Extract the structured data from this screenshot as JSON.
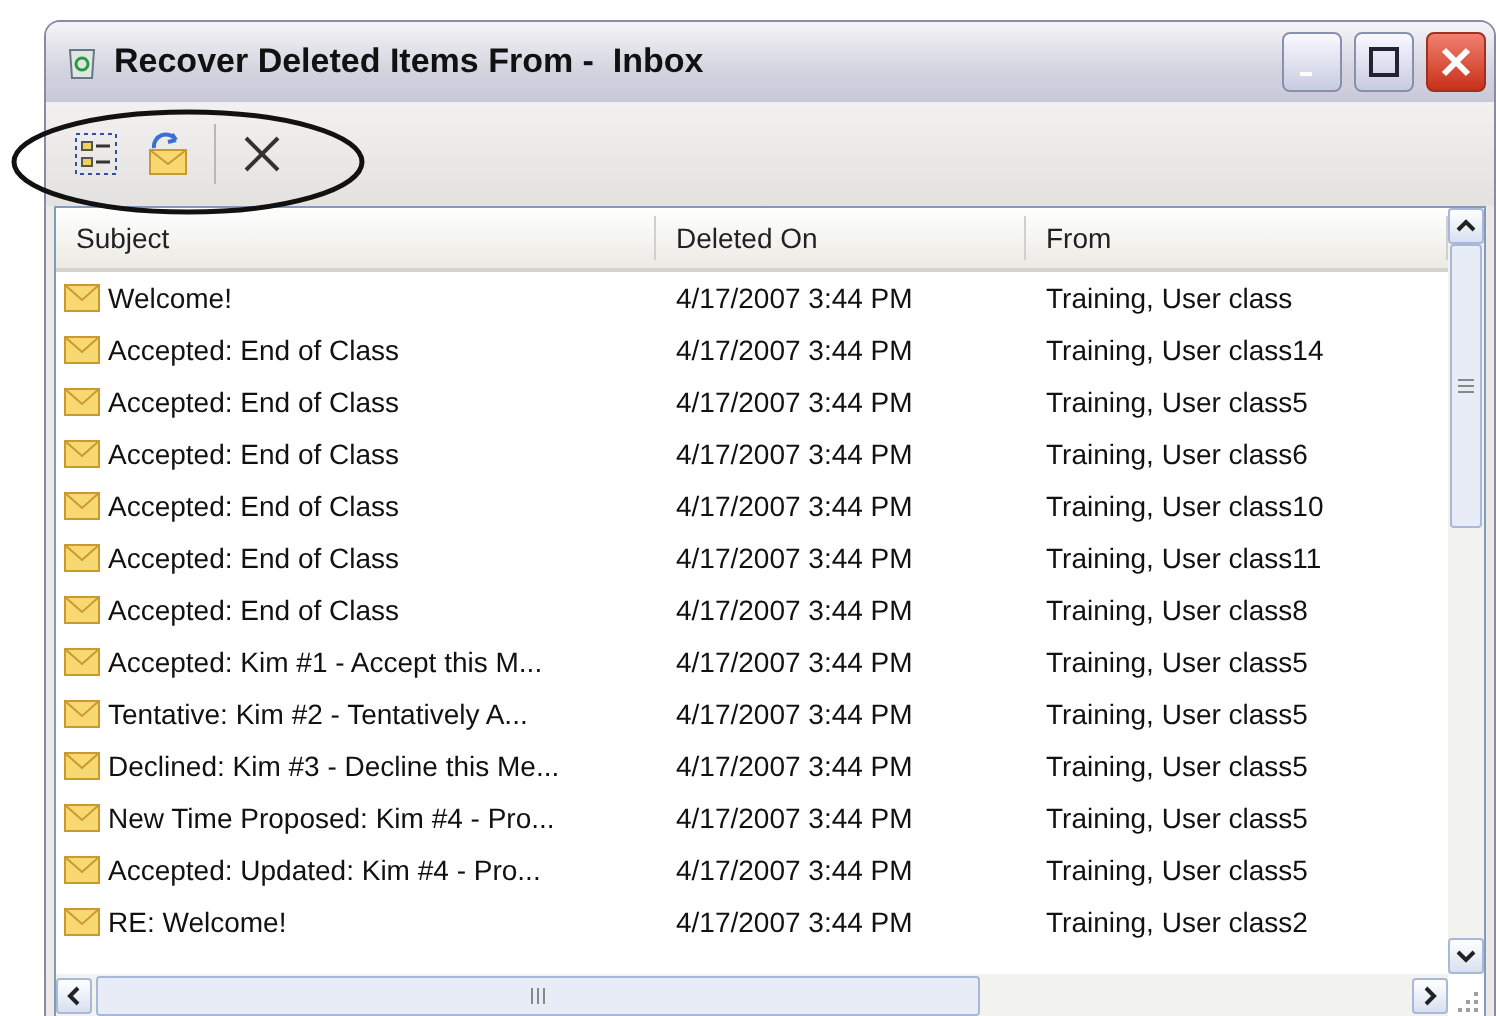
{
  "window": {
    "title": "Recover Deleted Items From -  Inbox"
  },
  "toolbar": {
    "buttons": [
      {
        "kind": "select"
      },
      {
        "kind": "recover"
      },
      {
        "kind": "separator"
      },
      {
        "kind": "delete"
      }
    ]
  },
  "table": {
    "columns": [
      "Subject",
      "Deleted On",
      "From"
    ],
    "rows": [
      {
        "subject": "Welcome!",
        "deleted_on": "4/17/2007 3:44 PM",
        "from": "Training, User class"
      },
      {
        "subject": "Accepted: End of Class",
        "deleted_on": "4/17/2007 3:44 PM",
        "from": "Training, User class14"
      },
      {
        "subject": "Accepted: End of Class",
        "deleted_on": "4/17/2007 3:44 PM",
        "from": "Training, User class5"
      },
      {
        "subject": "Accepted: End of Class",
        "deleted_on": "4/17/2007 3:44 PM",
        "from": "Training, User class6"
      },
      {
        "subject": "Accepted: End of Class",
        "deleted_on": "4/17/2007 3:44 PM",
        "from": "Training, User class10"
      },
      {
        "subject": "Accepted: End of Class",
        "deleted_on": "4/17/2007 3:44 PM",
        "from": "Training, User class11"
      },
      {
        "subject": "Accepted: End of Class",
        "deleted_on": "4/17/2007 3:44 PM",
        "from": "Training, User class8"
      },
      {
        "subject": "Accepted: Kim #1 - Accept this M...",
        "deleted_on": "4/17/2007 3:44 PM",
        "from": "Training, User class5"
      },
      {
        "subject": "Tentative: Kim #2 - Tentatively A...",
        "deleted_on": "4/17/2007 3:44 PM",
        "from": "Training, User class5"
      },
      {
        "subject": "Declined: Kim #3 - Decline this Me...",
        "deleted_on": "4/17/2007 3:44 PM",
        "from": "Training, User class5"
      },
      {
        "subject": "New Time Proposed: Kim #4 - Pro...",
        "deleted_on": "4/17/2007 3:44 PM",
        "from": "Training, User class5"
      },
      {
        "subject": "Accepted: Updated: Kim #4 - Pro...",
        "deleted_on": "4/17/2007 3:44 PM",
        "from": "Training, User class5"
      },
      {
        "subject": "RE: Welcome!",
        "deleted_on": "4/17/2007 3:44 PM",
        "from": "Training, User class2"
      }
    ]
  }
}
